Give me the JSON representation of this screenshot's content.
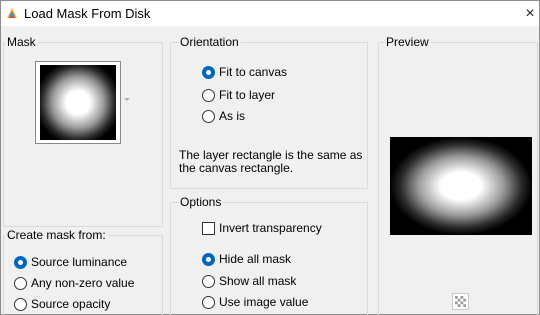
{
  "window": {
    "title": "Load Mask From Disk",
    "close_glyph": "×"
  },
  "mask": {
    "label": "Mask"
  },
  "create_mask": {
    "label": "Create mask from:",
    "options": [
      {
        "label": "Source luminance",
        "checked": true
      },
      {
        "label": "Any non-zero value",
        "checked": false
      },
      {
        "label": "Source opacity",
        "checked": false
      }
    ]
  },
  "orientation": {
    "label": "Orientation",
    "options": [
      {
        "label": "Fit to canvas",
        "checked": true
      },
      {
        "label": "Fit to layer",
        "checked": false
      },
      {
        "label": "As is",
        "checked": false
      }
    ],
    "note": "The layer rectangle is the same as the canvas rectangle."
  },
  "options": {
    "label": "Options",
    "invert_transparency": {
      "label": "Invert transparency",
      "checked": false
    },
    "radios": [
      {
        "label": "Hide all mask",
        "checked": true
      },
      {
        "label": "Show all mask",
        "checked": false
      },
      {
        "label": "Use image value",
        "checked": false
      }
    ]
  },
  "preview": {
    "label": "Preview"
  },
  "colors": {
    "accent": "#0067c0",
    "background": "#f0f0f0",
    "title_bar": "#ffffff"
  },
  "icons": {
    "app": "paint-program-icon",
    "close": "close-icon",
    "checker": "transparency-checker-icon"
  }
}
